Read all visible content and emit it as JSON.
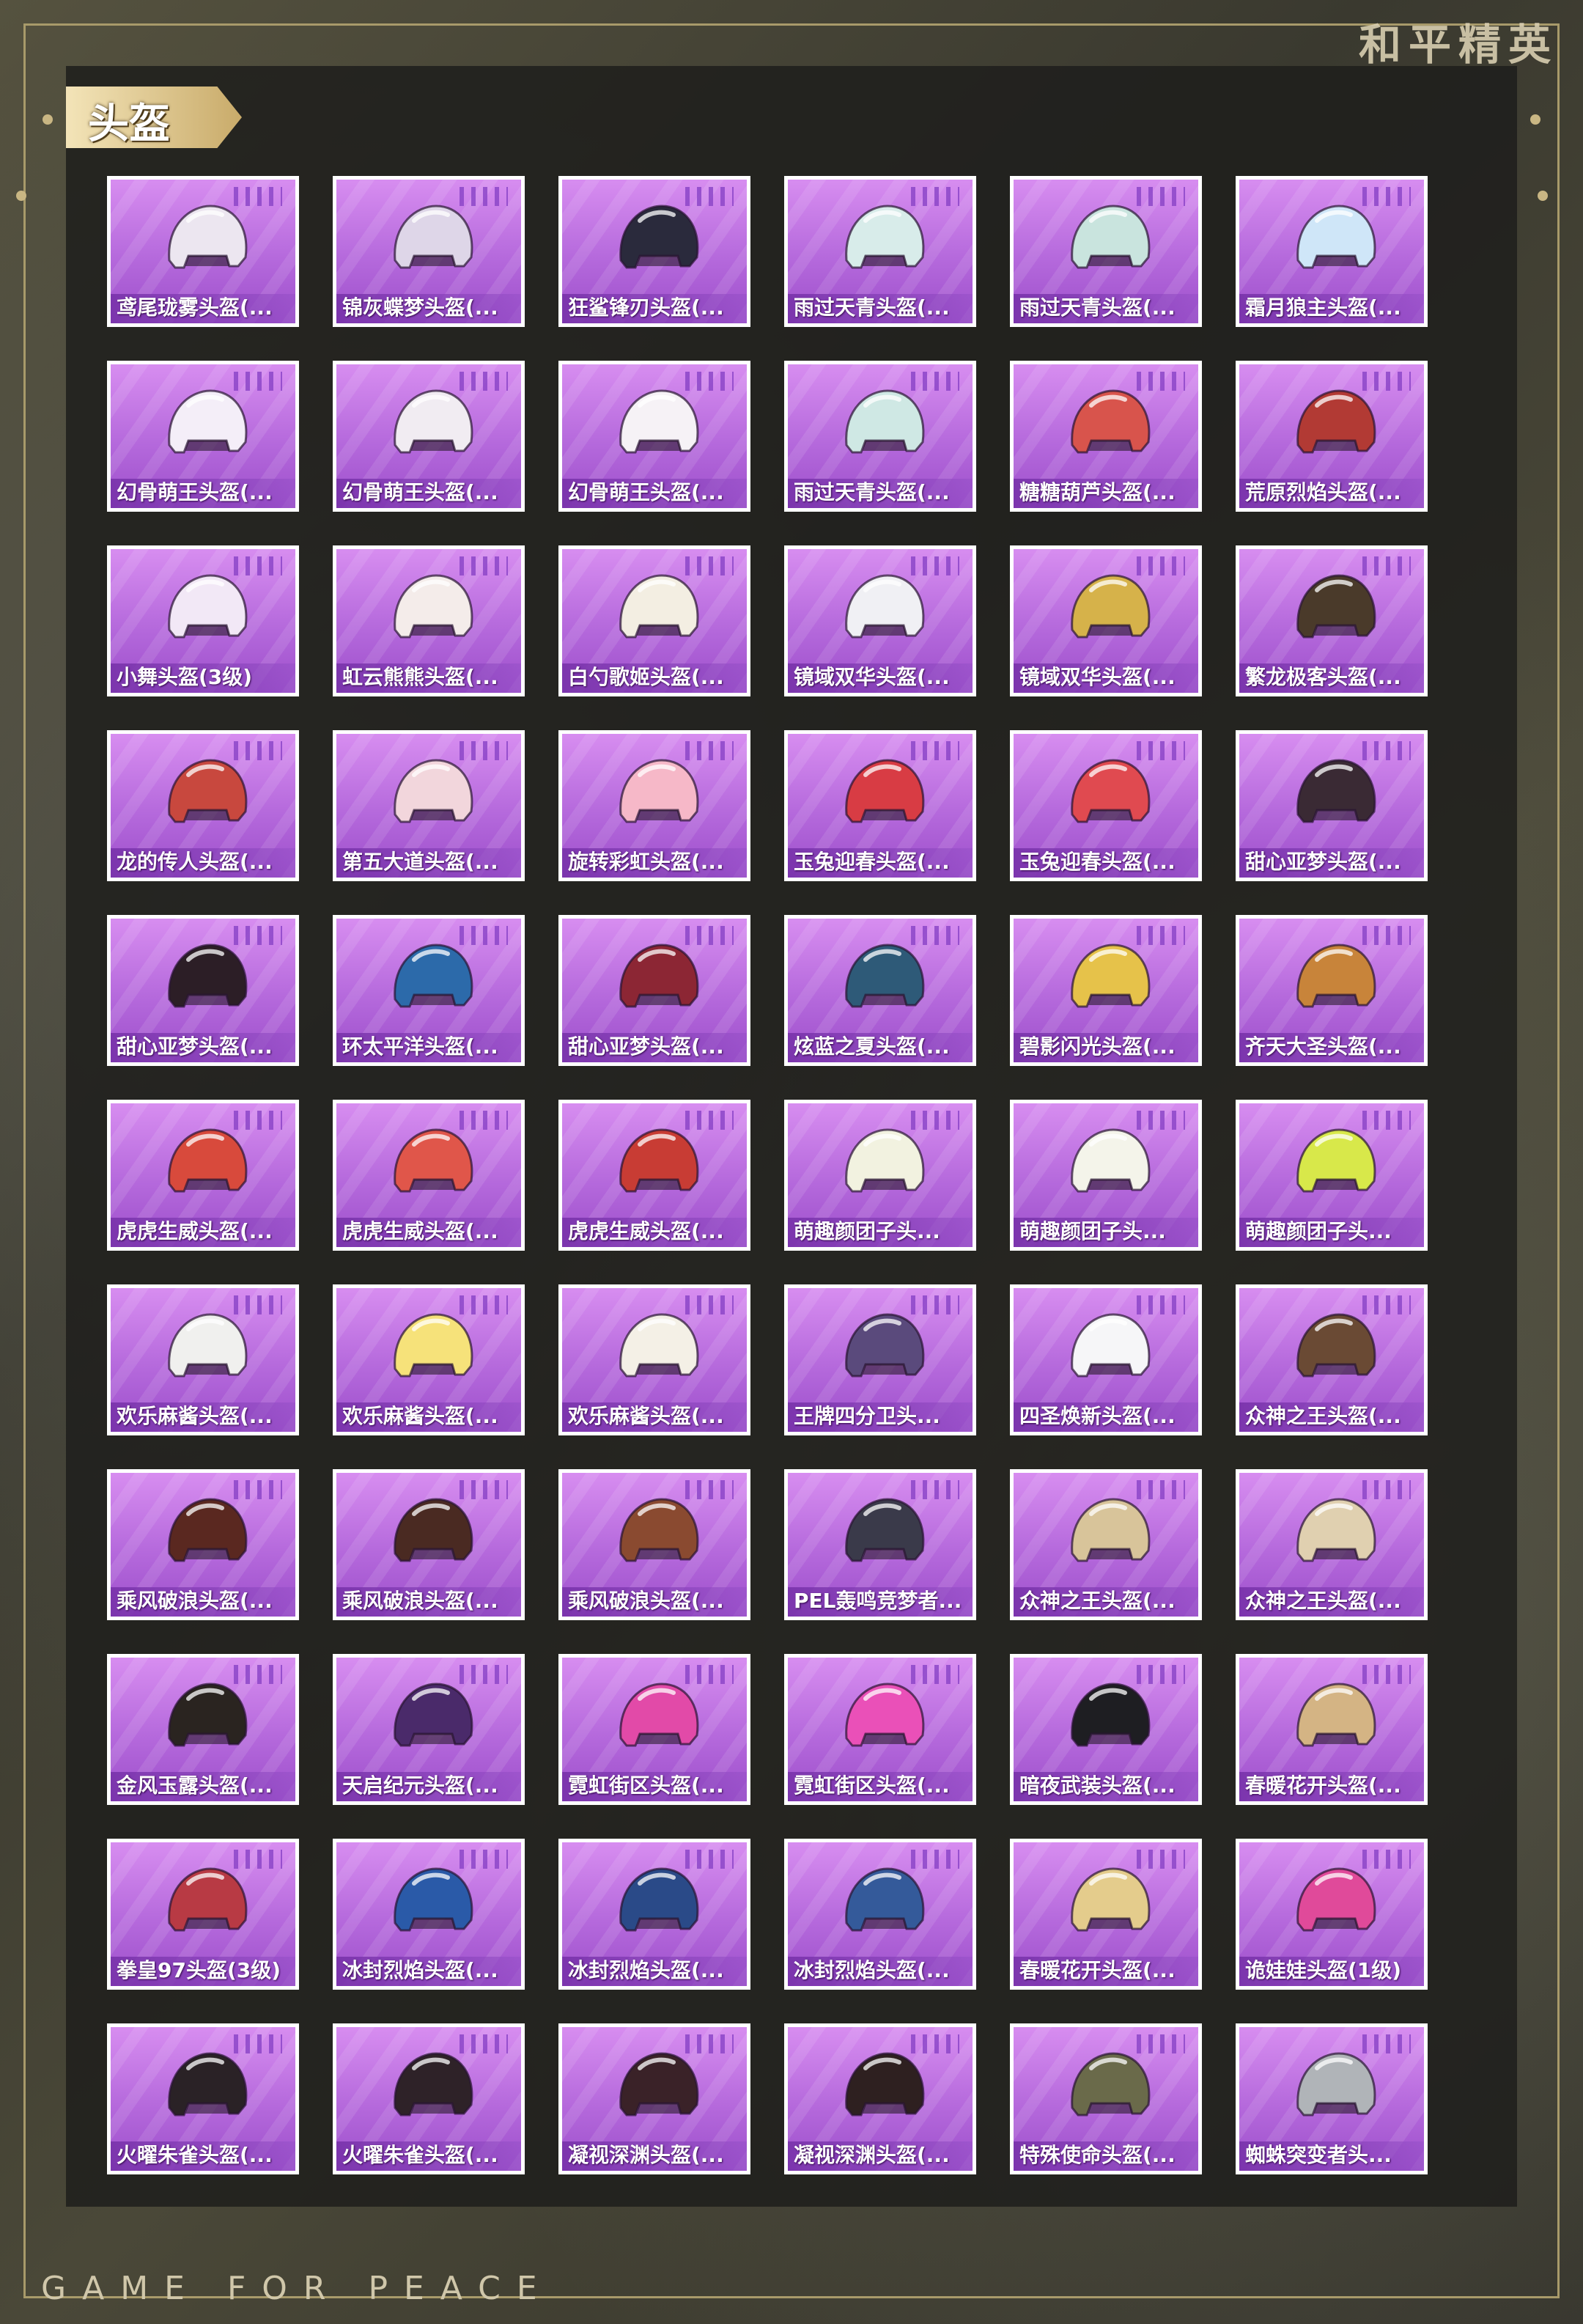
{
  "brand": "和平精英",
  "footer": "GAME FOR PEACE",
  "section": {
    "title": "头盔"
  },
  "colors": {
    "card_purple": "#b569dc",
    "tab_gold": "#d9bf80",
    "frame": "#a89a6a"
  },
  "rows": [
    [
      {
        "label": "鸢尾珑雾头盔(...",
        "color": "#ece6f0"
      },
      {
        "label": "锦灰蝶梦头盔(...",
        "color": "#ded6e8"
      },
      {
        "label": "狂鲨锋刃头盔(...",
        "color": "#2a2a3c"
      },
      {
        "label": "雨过天青头盔(...",
        "color": "#d8ecea"
      },
      {
        "label": "雨过天青头盔(...",
        "color": "#c9e4de"
      },
      {
        "label": "霜月狼主头盔(...",
        "color": "#cfe6f8"
      }
    ],
    [
      {
        "label": "幻骨萌王头盔(...",
        "color": "#f4eef8"
      },
      {
        "label": "幻骨萌王头盔(...",
        "color": "#f1ecf2"
      },
      {
        "label": "幻骨萌王头盔(...",
        "color": "#f6f2f6"
      },
      {
        "label": "雨过天青头盔(...",
        "color": "#cfe8e4"
      },
      {
        "label": "糖糖葫芦头盔(...",
        "color": "#d8544c"
      },
      {
        "label": "荒原烈焰头盔(...",
        "color": "#b23a34"
      }
    ],
    [
      {
        "label": "小舞头盔(3级)",
        "color": "#f2e8f6"
      },
      {
        "label": "虹云熊熊头盔(...",
        "color": "#f4ecea"
      },
      {
        "label": "白勺歌姬头盔(...",
        "color": "#f3eee2"
      },
      {
        "label": "镜域双华头盔(...",
        "color": "#f0f0f4"
      },
      {
        "label": "镜域双华头盔(...",
        "color": "#d6b24a"
      },
      {
        "label": "繁龙极客头盔(...",
        "color": "#4a3a2a"
      }
    ],
    [
      {
        "label": "龙的传人头盔(...",
        "color": "#c8483e"
      },
      {
        "label": "第五大道头盔(...",
        "color": "#f2d6dc"
      },
      {
        "label": "旋转彩虹头盔(...",
        "color": "#f6b8c8"
      },
      {
        "label": "玉兔迎春头盔(...",
        "color": "#d83c44"
      },
      {
        "label": "玉兔迎春头盔(...",
        "color": "#e04a50"
      },
      {
        "label": "甜心亚梦头盔(...",
        "color": "#3a2a34"
      }
    ],
    [
      {
        "label": "甜心亚梦头盔(...",
        "color": "#2c1e26"
      },
      {
        "label": "环太平洋头盔(...",
        "color": "#2c6aaa"
      },
      {
        "label": "甜心亚梦头盔(...",
        "color": "#8c2634"
      },
      {
        "label": "炫蓝之夏头盔(...",
        "color": "#2e5a78"
      },
      {
        "label": "碧影闪光头盔(...",
        "color": "#e6c24a"
      },
      {
        "label": "齐天大圣头盔(...",
        "color": "#c8843a"
      }
    ],
    [
      {
        "label": "虎虎生威头盔(...",
        "color": "#d84a3c"
      },
      {
        "label": "虎虎生威头盔(...",
        "color": "#e0564a"
      },
      {
        "label": "虎虎生威头盔(...",
        "color": "#c83c34"
      },
      {
        "label": "萌趣颜团子头...",
        "color": "#f2f2e0"
      },
      {
        "label": "萌趣颜团子头...",
        "color": "#f4f4ea"
      },
      {
        "label": "萌趣颜团子头...",
        "color": "#d8e84a"
      }
    ],
    [
      {
        "label": "欢乐麻酱头盔(...",
        "color": "#f0f0ee"
      },
      {
        "label": "欢乐麻酱头盔(...",
        "color": "#f6e27a"
      },
      {
        "label": "欢乐麻酱头盔(...",
        "color": "#f4f0e6"
      },
      {
        "label": "王牌四分卫头...",
        "color": "#5a4a7c"
      },
      {
        "label": "四圣焕新头盔(...",
        "color": "#f6f6f8"
      },
      {
        "label": "众神之王头盔(...",
        "color": "#6a4a34"
      }
    ],
    [
      {
        "label": "乘风破浪头盔(...",
        "color": "#5a2820"
      },
      {
        "label": "乘风破浪头盔(...",
        "color": "#4a2a22"
      },
      {
        "label": "乘风破浪头盔(...",
        "color": "#8a4a30"
      },
      {
        "label": "PEL轰鸣竞梦者...",
        "color": "#3a3a4a"
      },
      {
        "label": "众神之王头盔(...",
        "color": "#d8c49a"
      },
      {
        "label": "众神之王头盔(...",
        "color": "#e0d0b0"
      }
    ],
    [
      {
        "label": "金风玉露头盔(...",
        "color": "#2a2420"
      },
      {
        "label": "天启纪元头盔(...",
        "color": "#4a2a6a"
      },
      {
        "label": "霓虹街区头盔(...",
        "color": "#e24aa8"
      },
      {
        "label": "霓虹街区头盔(...",
        "color": "#ea50b8"
      },
      {
        "label": "暗夜武装头盔(...",
        "color": "#1e1e22"
      },
      {
        "label": "春暖花开头盔(...",
        "color": "#d4b484"
      }
    ],
    [
      {
        "label": "拳皇97头盔(3级)",
        "color": "#b83a44"
      },
      {
        "label": "冰封烈焰头盔(...",
        "color": "#2a5aa8"
      },
      {
        "label": "冰封烈焰头盔(...",
        "color": "#2a4a88"
      },
      {
        "label": "冰封烈焰头盔(...",
        "color": "#345a9a"
      },
      {
        "label": "春暖花开头盔(...",
        "color": "#e4cc8c"
      },
      {
        "label": "诡娃娃头盔(1级)",
        "color": "#e04a9a"
      }
    ],
    [
      {
        "label": "火曜朱雀头盔(...",
        "color": "#2a2226"
      },
      {
        "label": "火曜朱雀头盔(...",
        "color": "#2e2228"
      },
      {
        "label": "凝视深渊头盔(...",
        "color": "#3a2228"
      },
      {
        "label": "凝视深渊头盔(...",
        "color": "#2e2020"
      },
      {
        "label": "特殊使命头盔(...",
        "color": "#6a6a4a"
      },
      {
        "label": "蜘蛛突变者头...",
        "color": "#b0b4b8"
      }
    ]
  ]
}
